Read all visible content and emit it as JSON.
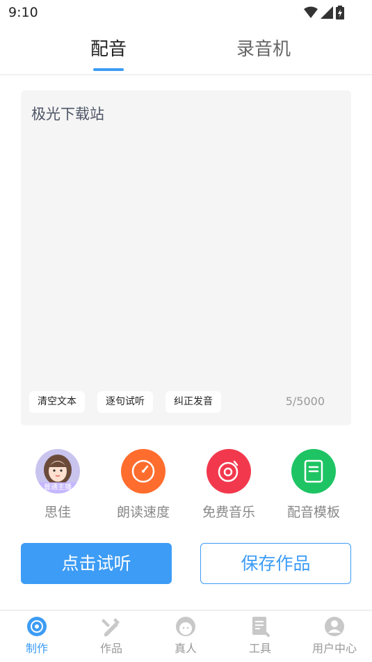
{
  "status_bar": {
    "time": "9:10"
  },
  "tabs": [
    {
      "label": "配音",
      "active": true
    },
    {
      "label": "录音机",
      "active": false
    }
  ],
  "editor": {
    "text": "极光下载站",
    "char_count": "5/5000",
    "chips": {
      "clear": "清空文本",
      "sentence": "逐句试听",
      "correct": "纠正发音"
    }
  },
  "features": {
    "voice": {
      "label": "思佳",
      "badge": "普通主播",
      "icon": "avatar"
    },
    "speed": {
      "label": "朗读速度",
      "icon": "speedometer-icon",
      "color": "#ff6d2e"
    },
    "music": {
      "label": "免费音乐",
      "icon": "music-disc-icon",
      "color": "#f2384d"
    },
    "template": {
      "label": "配音模板",
      "icon": "document-icon",
      "color": "#1ec463"
    }
  },
  "buttons": {
    "listen": "点击试听",
    "save": "保存作品"
  },
  "bottom_nav": [
    {
      "label": "制作",
      "icon": "disc-icon",
      "active": true
    },
    {
      "label": "作品",
      "icon": "pencil-ruler-icon",
      "active": false
    },
    {
      "label": "真人",
      "icon": "person-face-icon",
      "active": false
    },
    {
      "label": "工具",
      "icon": "tools-doc-icon",
      "active": false
    },
    {
      "label": "用户中心",
      "icon": "user-icon",
      "active": false
    }
  ],
  "colors": {
    "accent": "#3d9cf5",
    "nav_inactive": "#c8c8c8"
  }
}
